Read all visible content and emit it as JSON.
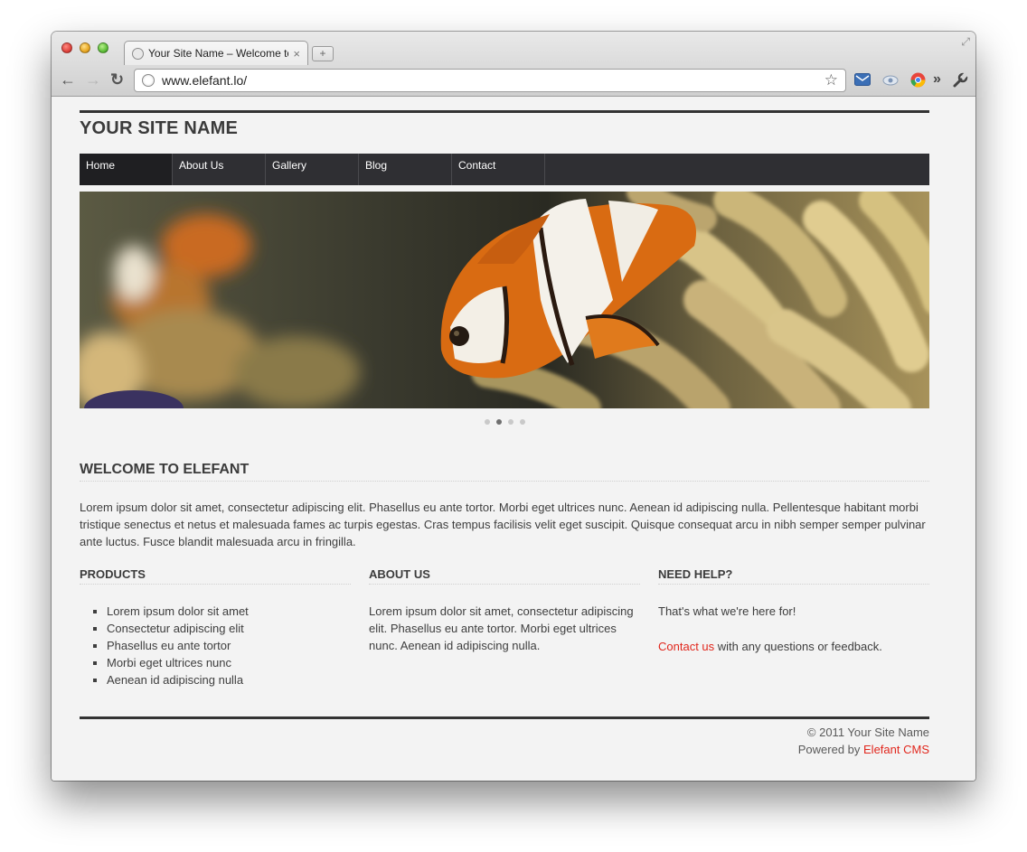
{
  "browser": {
    "tab_title": "Your Site Name – Welcome to",
    "url": "www.elefant.lo/",
    "new_tab_symbol": "+",
    "close_symbol": "×",
    "back_symbol": "←",
    "forward_symbol": "→",
    "reload_symbol": "↻",
    "star_symbol": "☆",
    "overflow_symbol": "»",
    "wrench_symbol": "🔧",
    "icons": [
      "globe-icon",
      "mail-icon",
      "cloud-icon",
      "chrome-icon",
      "wrench-icon"
    ]
  },
  "site": {
    "name": "YOUR SITE NAME",
    "nav": [
      "Home",
      "About Us",
      "Gallery",
      "Blog",
      "Contact"
    ],
    "active_nav": 0,
    "slider": {
      "slides": 4,
      "active": 1
    }
  },
  "welcome": {
    "heading": "WELCOME TO ELEFANT",
    "body": "Lorem ipsum dolor sit amet, consectetur adipiscing elit. Phasellus eu ante tortor. Morbi eget ultrices nunc. Aenean id adipiscing nulla. Pellentesque habitant morbi tristique senectus et netus et malesuada fames ac turpis egestas. Cras tempus facilisis velit eget suscipit. Quisque consequat arcu in nibh semper semper pulvinar ante luctus. Fusce blandit malesuada arcu in fringilla."
  },
  "products": {
    "heading": "PRODUCTS",
    "items": [
      "Lorem ipsum dolor sit amet",
      "Consectetur adipiscing elit",
      "Phasellus eu ante tortor",
      "Morbi eget ultrices nunc",
      "Aenean id adipiscing nulla"
    ]
  },
  "about": {
    "heading": "ABOUT US",
    "body": "Lorem ipsum dolor sit amet, consectetur adipiscing elit. Phasellus eu ante tortor. Morbi eget ultrices nunc. Aenean id adipiscing nulla."
  },
  "help": {
    "heading": "NEED HELP?",
    "line1": "That's what we're here for!",
    "contact_link": "Contact us",
    "line2_rest": " with any questions or feedback."
  },
  "footer": {
    "copyright": "© 2011 Your Site Name",
    "powered_prefix": "Powered by ",
    "powered_link": "Elefant CMS"
  },
  "colors": {
    "accent": "#e1261c",
    "nav_bg": "#2f2f33",
    "text": "#3e3e3e"
  }
}
